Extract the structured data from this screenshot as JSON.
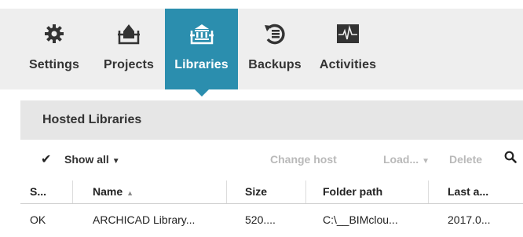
{
  "nav": {
    "items": [
      {
        "id": "settings",
        "label": "Settings",
        "icon": "gear-icon"
      },
      {
        "id": "projects",
        "label": "Projects",
        "icon": "projects-icon"
      },
      {
        "id": "libraries",
        "label": "Libraries",
        "icon": "library-icon",
        "active": true
      },
      {
        "id": "backups",
        "label": "Backups",
        "icon": "backup-icon"
      },
      {
        "id": "activities",
        "label": "Activities",
        "icon": "activity-monitor-icon"
      }
    ],
    "active_color": "#2b8eae"
  },
  "section": {
    "title": "Hosted Libraries"
  },
  "toolbar": {
    "show_all_label": "Show all",
    "change_host_label": "Change host",
    "load_label": "Load...",
    "delete_label": "Delete"
  },
  "table": {
    "columns": [
      {
        "label": "S..."
      },
      {
        "label": "Name",
        "sorted": "ascending"
      },
      {
        "label": "Size"
      },
      {
        "label": "Folder path"
      },
      {
        "label": "Last a..."
      }
    ],
    "rows": [
      {
        "status": "OK",
        "name": "ARCHICAD Library...",
        "size": "520....",
        "folder_path": "C:\\__BIMclou...",
        "last_accessed": "2017.0..."
      }
    ]
  }
}
